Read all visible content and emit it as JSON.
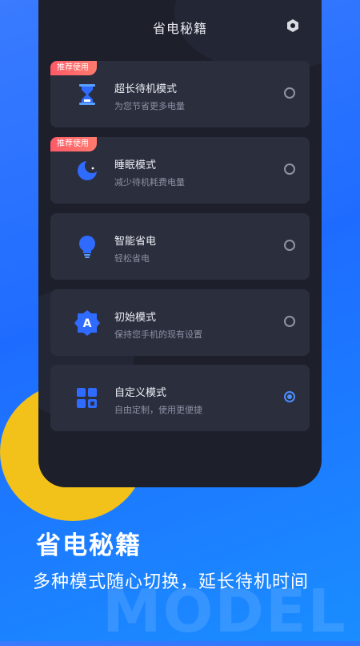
{
  "header": {
    "title": "省电秘籍"
  },
  "modes": [
    {
      "badge": "推荐使用",
      "title": "超长待机模式",
      "subtitle": "为您节省更多电量",
      "selected": false,
      "icon": "hourglass-icon"
    },
    {
      "badge": "推荐使用",
      "title": "睡眠模式",
      "subtitle": "减少待机耗费电量",
      "selected": false,
      "icon": "moon-icon"
    },
    {
      "badge": "",
      "title": "智能省电",
      "subtitle": "轻松省电",
      "selected": false,
      "icon": "lightbulb-icon"
    },
    {
      "badge": "",
      "title": "初始模式",
      "subtitle": "保持您手机的现有设置",
      "selected": false,
      "icon": "letter-a-badge-icon"
    },
    {
      "badge": "",
      "title": "自定义模式",
      "subtitle": "自由定制，使用更便捷",
      "selected": true,
      "icon": "grid-apps-icon"
    }
  ],
  "promo": {
    "title": "省电秘籍",
    "subtitle": "多种模式随心切换，延长待机时间",
    "watermark": "MODEL"
  },
  "colors": {
    "accent": "#4b8dff",
    "badge": "#ff5a66",
    "background": "#1e6cff",
    "card": "#2b2e3d"
  }
}
